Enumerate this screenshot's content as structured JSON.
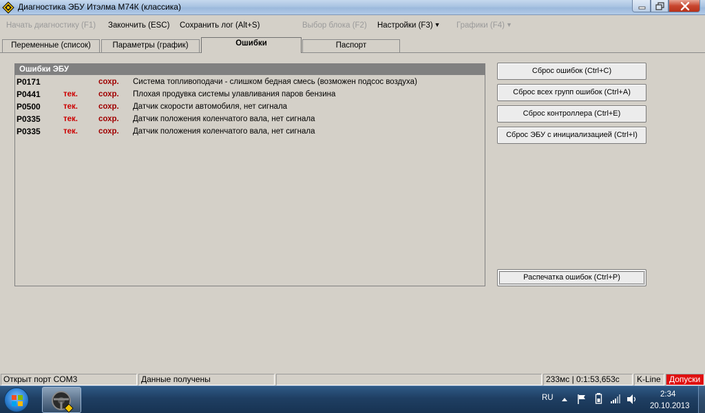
{
  "window": {
    "title": "Диагностика ЭБУ Итэлма М74К (классика)"
  },
  "menu": {
    "start_diag": "Начать диагностику (F1)",
    "finish": "Закончить (ESC)",
    "save_log": "Сохранить лог (Alt+S)",
    "select_block": "Выбор блока (F2)",
    "settings": "Настройки (F3)",
    "graphs": "Графики (F4)"
  },
  "tabs": {
    "variables": "Переменные (список)",
    "params": "Параметры (график)",
    "errors": "Ошибки",
    "passport": "Паспорт"
  },
  "errors_panel": {
    "title": "Ошибки ЭБУ",
    "rows": [
      {
        "code": "P0171",
        "current": "",
        "saved": "сохр.",
        "desc": "Система топливоподачи - слишком бедная смесь (возможен подсос воздуха)"
      },
      {
        "code": "P0441",
        "current": "тек.",
        "saved": "сохр.",
        "desc": "Плохая продувка системы улавливания паров бензина"
      },
      {
        "code": "P0500",
        "current": "тек.",
        "saved": "сохр.",
        "desc": "Датчик скорости автомобиля, нет сигнала"
      },
      {
        "code": "P0335",
        "current": "тек.",
        "saved": "сохр.",
        "desc": "Датчик положения коленчатого вала, нет сигнала"
      },
      {
        "code": "P0335",
        "current": "тек.",
        "saved": "сохр.",
        "desc": "Датчик положения коленчатого вала, нет сигнала"
      }
    ]
  },
  "buttons": {
    "reset_errors": "Сброс ошибок (Ctrl+C)",
    "reset_all": "Сброс всех групп ошибок (Ctrl+A)",
    "reset_controller": "Сброс контроллера (Ctrl+E)",
    "reset_init": "Сброс ЭБУ с инициализацией (Ctrl+I)",
    "print_errors": "Распечатка ошибок (Ctrl+P)"
  },
  "status": {
    "port": "Открыт порт COM3",
    "data": "Данные получены",
    "empty": "",
    "timing": "233мс | 0:1:53,653с",
    "protocol": "K-Line",
    "tolerance": "Допуски"
  },
  "taskbar": {
    "lang": "RU",
    "time": "2:34",
    "date": "20.10.2013"
  },
  "colors": {
    "panel_bg": "#d4d0c8",
    "header_bg": "#808080",
    "current_red": "#cc0000",
    "saved_red": "#a00000",
    "status_red": "#e01010"
  }
}
